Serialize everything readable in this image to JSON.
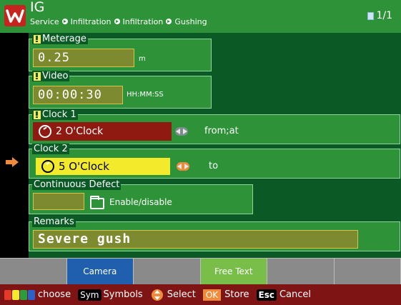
{
  "header": {
    "title": "IG",
    "breadcrumb": [
      "Service",
      "Infiltration",
      "Infiltration",
      "Gushing"
    ],
    "pager": "1/1"
  },
  "form": {
    "meterage": {
      "label": "Meterage",
      "value": "0.25",
      "unit": "m"
    },
    "video": {
      "label": "Video",
      "value": "00:00:30",
      "unit": "HH:MM:SS"
    },
    "clock1": {
      "label": "Clock 1",
      "value": "2 O'Clock",
      "assoc": "from;at"
    },
    "clock2": {
      "label": "Clock 2",
      "value": "5 O'Clock",
      "assoc": "to"
    },
    "continuous_defect": {
      "label": "Continuous Defect",
      "toggle_label": "Enable/disable"
    },
    "remarks": {
      "label": "Remarks",
      "value": "Severe gush"
    }
  },
  "softkeys": [
    "",
    "Camera",
    "",
    "Free Text",
    "",
    ""
  ],
  "footer": {
    "choose": "choose",
    "sym_key": "Sym",
    "symbols": "Symbols",
    "select": "Select",
    "ok_key": "OK",
    "store": "Store",
    "esc_key": "Esc",
    "cancel": "Cancel"
  },
  "colors": {
    "header_green": "#2e9338",
    "panel_green": "#0b5a26",
    "clock1_red": "#8e1a12",
    "clock2_yellow": "#f2ea2a",
    "accent_orange": "#f08b3c",
    "footer_red": "#7f1414",
    "softkey_blue": "#1f5fae",
    "softkey_green": "#78be48"
  },
  "icons": {
    "logo": "w-logo-icon",
    "pager": "document-icon",
    "mandatory": "exclamation-flag-icon",
    "clock": "clock-icon",
    "adjust": "left-right-arrows-icon",
    "folder": "open-folder-icon",
    "pointer": "arrow-right-icon"
  }
}
